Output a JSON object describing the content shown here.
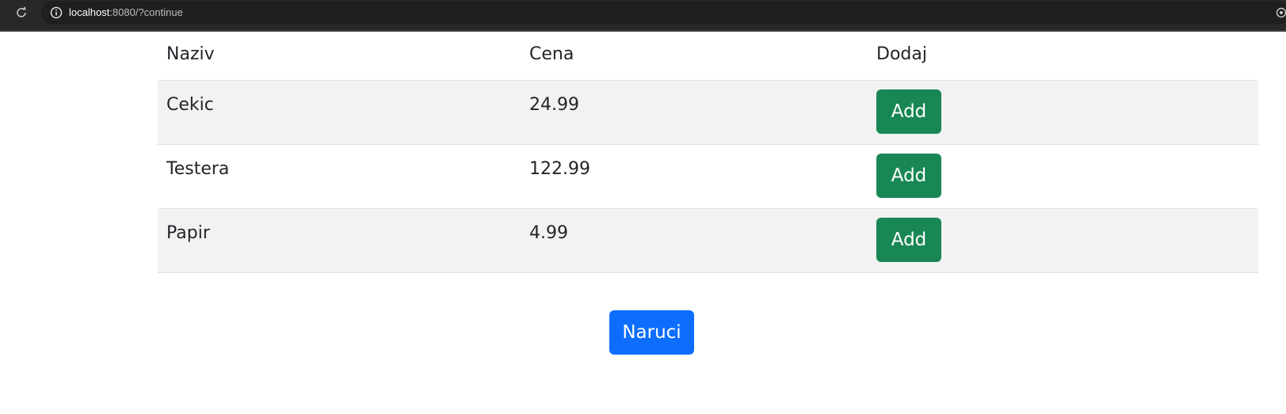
{
  "browser": {
    "url_host": "localhost",
    "url_rest": ":8080/?continue",
    "reload_icon": "reload-icon",
    "info_icon": "site-info-icon",
    "extension_icon": "extension-icon"
  },
  "table": {
    "headers": [
      "Naziv",
      "Cena",
      "Dodaj"
    ],
    "rows": [
      {
        "name": "Cekic",
        "price": "24.99",
        "action": "Add"
      },
      {
        "name": "Testera",
        "price": "122.99",
        "action": "Add"
      },
      {
        "name": "Papir",
        "price": "4.99",
        "action": "Add"
      }
    ]
  },
  "order_button": "Naruci",
  "colors": {
    "add_button": "#198754",
    "order_button": "#0d6efd",
    "stripe": "#f2f2f2",
    "browser_bar": "#282828"
  }
}
